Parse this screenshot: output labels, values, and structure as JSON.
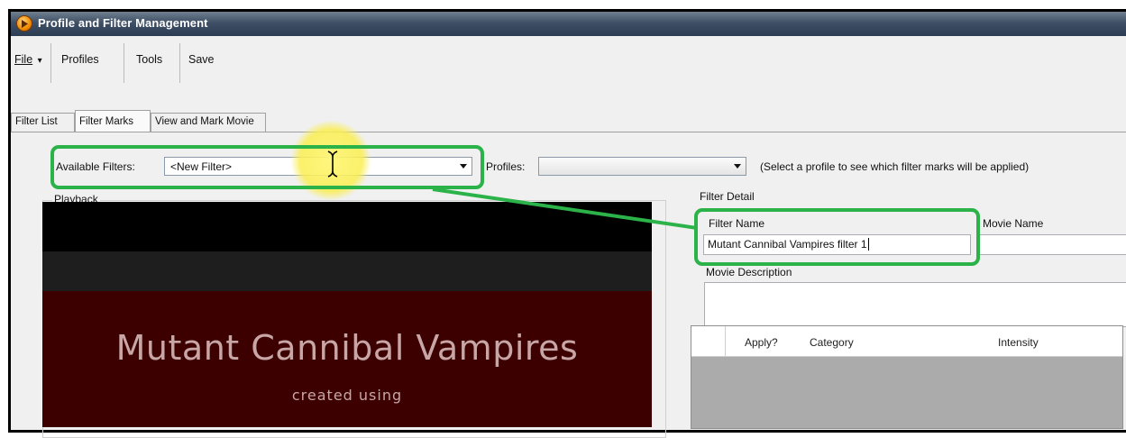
{
  "window": {
    "title": "Profile and Filter Management"
  },
  "menu": {
    "file": "File",
    "file_arrow": "▾",
    "profiles": "Profiles",
    "tools": "Tools",
    "save": "Save"
  },
  "tabs": [
    {
      "label": "Filter List"
    },
    {
      "label": "Filter Marks"
    },
    {
      "label": "View and Mark Movie"
    }
  ],
  "filters": {
    "available_label": "Available Filters:",
    "available_value": "<New Filter>",
    "profiles_label": "Profiles:",
    "profiles_value": "",
    "hint": "(Select a profile to see which filter marks will be applied)"
  },
  "playback": {
    "label": "Playback",
    "movie_title": "Mutant Cannibal Vampires",
    "movie_subtitle": "created using"
  },
  "filter_detail": {
    "label": "Filter Detail",
    "filter_name_label": "Filter Name",
    "filter_name_value": "Mutant Cannibal Vampires filter 1",
    "movie_name_label": "Movie Name",
    "movie_name_value": "",
    "movie_description_label": "Movie Description",
    "movie_description_value": ""
  },
  "marks_grid": {
    "columns": [
      "Apply?",
      "Category",
      "Intensity"
    ]
  },
  "annotation": {
    "color": "#2bb34a",
    "highlight_color": "#fbef58"
  }
}
